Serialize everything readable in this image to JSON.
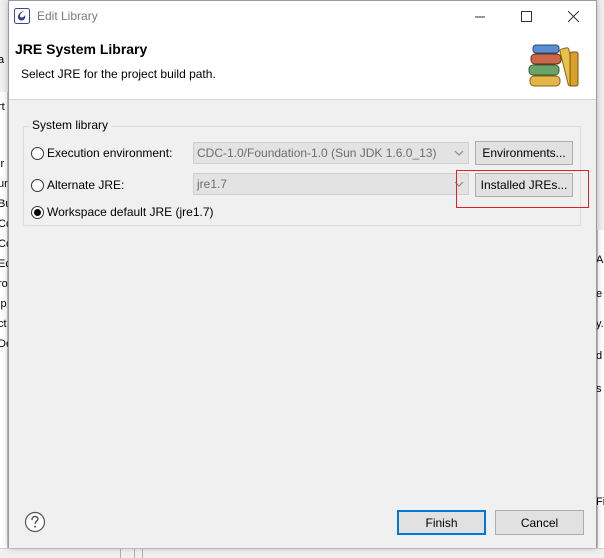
{
  "window": {
    "title": "Edit Library",
    "minimize_icon": "minimize-icon",
    "maximize_icon": "maximize-icon",
    "close_icon": "close-icon"
  },
  "banner": {
    "title": "JRE System Library",
    "description": "Select JRE for the project build path.",
    "image_icon": "library-books-icon"
  },
  "system_library": {
    "group_label": "System library",
    "options": [
      {
        "label": "Execution environment:",
        "selected": false
      },
      {
        "label": "Alternate JRE:",
        "selected": false
      },
      {
        "label": "Workspace default JRE (jre1.7)",
        "selected": true
      }
    ],
    "execution_environment_value": "CDC-1.0/Foundation-1.0 (Sun JDK 1.6.0_13)",
    "alternate_jre_value": "jre1.7",
    "environments_button": "Environments...",
    "installed_jres_button": "Installed JREs..."
  },
  "footer": {
    "help_icon": "help-icon",
    "finish_button": "Finish",
    "cancel_button": "Cancel"
  },
  "background": {
    "left_fragments": [
      "a",
      "rt",
      "ir",
      "ur",
      "er",
      "Bu",
      "Co",
      "Co",
      "Ec",
      "ro",
      "ip",
      "ct",
      "De"
    ],
    "right_fragments": [
      "A",
      "e",
      "y.",
      "d",
      "s",
      "Fil"
    ]
  },
  "colors": {
    "highlight_box": "#e02020",
    "default_button_border": "#0078d7"
  }
}
